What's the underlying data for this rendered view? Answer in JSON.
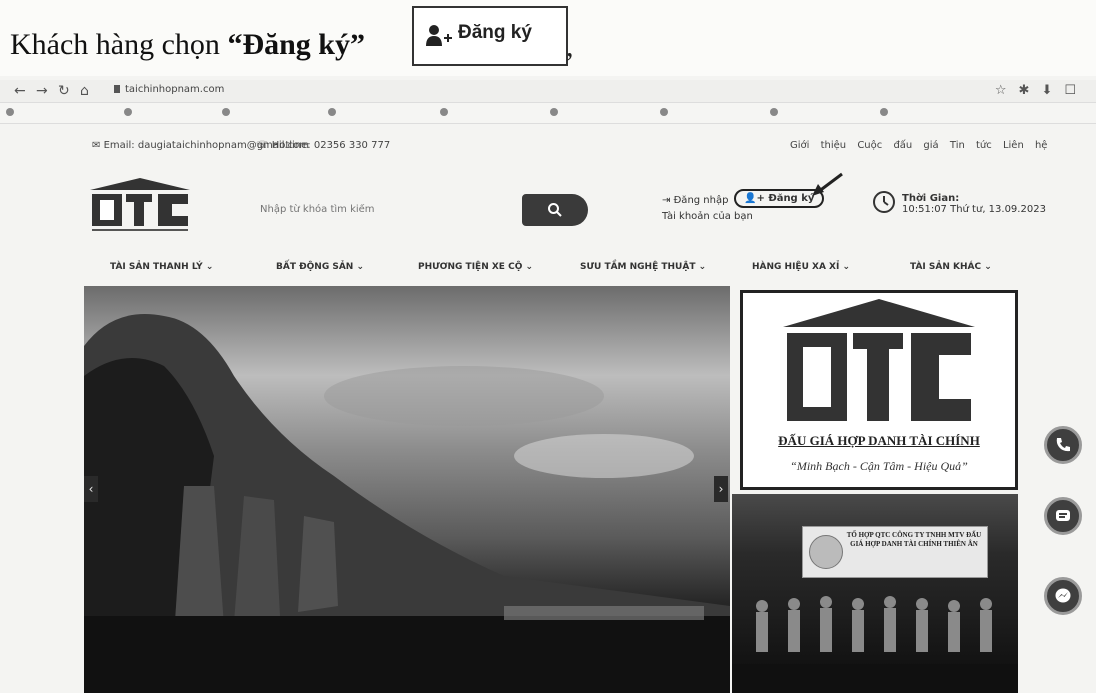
{
  "instruction": {
    "text_before": "Khách hàng chọn ",
    "text_bold": "“Đăng ký”",
    "button_label": "Đăng ký",
    "trailing": ","
  },
  "browser": {
    "url": "taichinhopnam.com"
  },
  "topbar": {
    "email": "Email: daugiataichinhopnam@gmail.com",
    "hotline": "Hotline: 02356 330 777",
    "links": [
      "Giới thiệu",
      "Cuộc đấu giá",
      "Tin tức",
      "Liên hệ"
    ]
  },
  "header": {
    "search_placeholder": "Nhập từ khóa tìm kiếm",
    "login_label": "Đăng nhập",
    "register_label": "Đăng ký",
    "account_sub": "Tài khoản của bạn",
    "time_label": "Thời Gian:",
    "time_value": "10:51:07 Thứ tư, 13.09.2023"
  },
  "menu": [
    "TÀI SẢN THANH LÝ",
    "BẤT ĐỘNG SẢN",
    "PHƯƠNG TIỆN XE CỘ",
    "SƯU TẦM NGHỆ THUẬT",
    "HÀNG HIỆU XA XỈ",
    "TÀI SẢN KHÁC"
  ],
  "promo": {
    "name": "ĐẤU GIÁ HỢP DANH TÀI CHÍNH",
    "slogan": "“Minh Bạch - Cận Tâm - Hiệu Quả”"
  },
  "event_banner": "TỔ HỢP QTC CÔNG TY TNHH MTV ĐẤU GIÁ HỢP DANH TÀI CHÍNH THIÊN ÂN",
  "colors": {
    "dark": "#2f2f2f",
    "paper": "#fbfbf9"
  },
  "floating": [
    "phone-icon",
    "zalo-icon",
    "messenger-icon"
  ]
}
